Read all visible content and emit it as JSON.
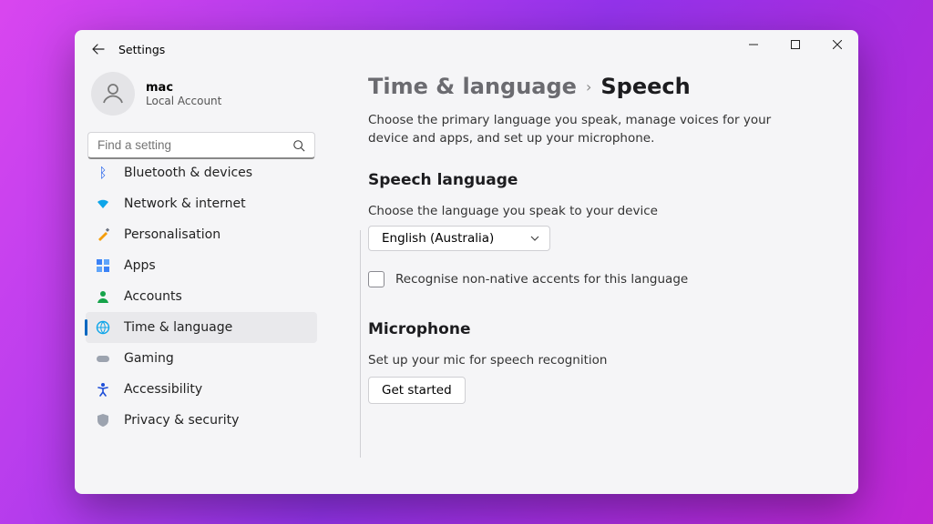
{
  "window": {
    "title": "Settings"
  },
  "account": {
    "name": "mac",
    "sub": "Local Account"
  },
  "search": {
    "placeholder": "Find a setting"
  },
  "sidebar": {
    "items": [
      {
        "label": "Bluetooth & devices"
      },
      {
        "label": "Network & internet"
      },
      {
        "label": "Personalisation"
      },
      {
        "label": "Apps"
      },
      {
        "label": "Accounts"
      },
      {
        "label": "Time & language"
      },
      {
        "label": "Gaming"
      },
      {
        "label": "Accessibility"
      },
      {
        "label": "Privacy & security"
      }
    ]
  },
  "breadcrumb": {
    "parent": "Time & language",
    "current": "Speech"
  },
  "page": {
    "description": "Choose the primary language you speak, manage voices for your device and apps, and set up your microphone.",
    "speech": {
      "heading": "Speech language",
      "sub": "Choose the language you speak to your device",
      "selected": "English (Australia)",
      "checkbox_label": "Recognise non-native accents for this language"
    },
    "mic": {
      "heading": "Microphone",
      "sub": "Set up your mic for speech recognition",
      "button": "Get started"
    }
  }
}
